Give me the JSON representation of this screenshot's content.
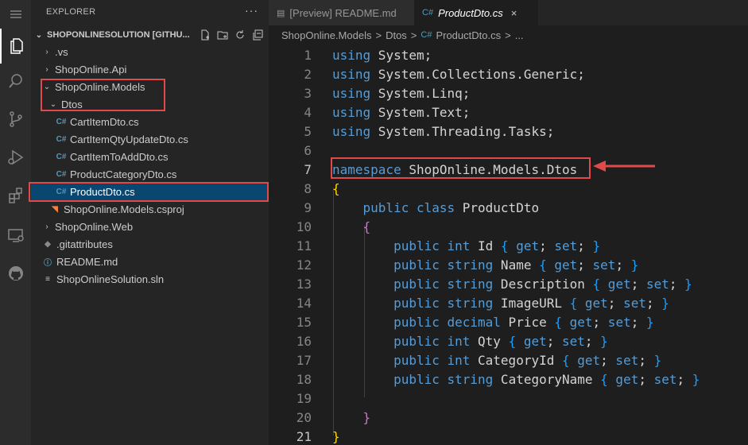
{
  "explorer": {
    "title": "EXPLORER",
    "more": "···",
    "root": "SHOPONLINESOLUTION [GITHU...",
    "items": [
      {
        "label": ".vs",
        "type": "folder",
        "expanded": false
      },
      {
        "label": "ShopOnline.Api",
        "type": "folder",
        "expanded": false
      },
      {
        "label": "ShopOnline.Models",
        "type": "folder",
        "expanded": true
      },
      {
        "label": "Dtos",
        "type": "folder",
        "expanded": true
      },
      {
        "label": "CartItemDto.cs",
        "type": "cs"
      },
      {
        "label": "CartItemQtyUpdateDto.cs",
        "type": "cs"
      },
      {
        "label": "CartItemToAddDto.cs",
        "type": "cs"
      },
      {
        "label": "ProductCategoryDto.cs",
        "type": "cs"
      },
      {
        "label": "ProductDto.cs",
        "type": "cs",
        "selected": true
      },
      {
        "label": "ShopOnline.Models.csproj",
        "type": "csproj"
      },
      {
        "label": "ShopOnline.Web",
        "type": "folder",
        "expanded": false
      },
      {
        "label": ".gitattributes",
        "type": "git"
      },
      {
        "label": "README.md",
        "type": "md"
      },
      {
        "label": "ShopOnlineSolution.sln",
        "type": "sln"
      }
    ]
  },
  "tabs": [
    {
      "label": "[Preview] README.md",
      "active": false,
      "icon": "preview-icon"
    },
    {
      "label": "ProductDto.cs",
      "active": true,
      "icon": "csharp-icon"
    }
  ],
  "tab_close": "×",
  "breadcrumb": [
    "ShopOnline.Models",
    "Dtos",
    "ProductDto.cs",
    "..."
  ],
  "breadcrumb_sep": ">",
  "code": {
    "line_numbers": [
      "1",
      "2",
      "3",
      "4",
      "5",
      "6",
      "7",
      "8",
      "9",
      "10",
      "11",
      "12",
      "13",
      "14",
      "15",
      "16",
      "17",
      "18",
      "19",
      "20",
      "21"
    ],
    "lines": [
      {
        "kw": "using",
        "rest": " System;"
      },
      {
        "kw": "using",
        "rest": " System.Collections.Generic;"
      },
      {
        "kw": "using",
        "rest": " System.Linq;"
      },
      {
        "kw": "using",
        "rest": " System.Text;"
      },
      {
        "kw": "using",
        "rest": " System.Threading.Tasks;"
      },
      {},
      {
        "kw": "namespace",
        "rest": " ShopOnline.Models.Dtos"
      },
      {
        "brace": "{"
      },
      {
        "indent": "    ",
        "kw": "public class",
        "rest": " ProductDto"
      },
      {
        "indent": "    ",
        "brace": "{"
      },
      {
        "indent": "        ",
        "kw": "public int",
        "rest": " Id ",
        "acc": {
          "open": "{",
          "get": " get;",
          "set": " set;",
          "close": " }"
        }
      },
      {
        "indent": "        ",
        "kw": "public string",
        "rest": " Name ",
        "acc": {
          "open": "{",
          "get": " get;",
          "set": " set;",
          "close": " }"
        }
      },
      {
        "indent": "        ",
        "kw": "public string",
        "rest": " Description ",
        "acc": {
          "open": "{",
          "get": " get;",
          "set": " set;",
          "close": " }"
        }
      },
      {
        "indent": "        ",
        "kw": "public string",
        "rest": " ImageURL ",
        "acc": {
          "open": "{",
          "get": " get;",
          "set": " set;",
          "close": " }"
        }
      },
      {
        "indent": "        ",
        "kw": "public decimal",
        "rest": " Price ",
        "acc": {
          "open": "{",
          "get": " get;",
          "set": " set;",
          "close": " }"
        }
      },
      {
        "indent": "        ",
        "kw": "public int",
        "rest": " Qty ",
        "acc": {
          "open": "{",
          "get": " get;",
          "set": " set;",
          "close": " }"
        }
      },
      {
        "indent": "        ",
        "kw": "public int",
        "rest": " CategoryId ",
        "acc": {
          "open": "{",
          "get": " get;",
          "set": " set;",
          "close": " }"
        }
      },
      {
        "indent": "        ",
        "kw": "public string",
        "rest": " CategoryName ",
        "acc": {
          "open": "{",
          "get": " get;",
          "set": " set;",
          "close": " }"
        }
      },
      {},
      {
        "indent": "    ",
        "brace": "}"
      },
      {
        "brace": "}"
      }
    ]
  },
  "colors": {
    "keyword": "#569cd6",
    "annotation": "#e04a4a",
    "selection": "#094771"
  }
}
